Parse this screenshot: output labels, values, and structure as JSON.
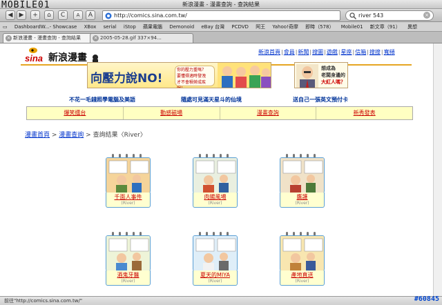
{
  "window": {
    "title": "新浪漫畫 - 漫畫查詢 - 查詢結果",
    "watermark": "MOBILE01"
  },
  "toolbar": {
    "back": "◀",
    "forward": "▶",
    "add": "+",
    "home": "⌂",
    "reload": "C",
    "text_smaller": "A",
    "text_larger": "A",
    "url": "http://comics.sina.com.tw/",
    "search_value": "river 543"
  },
  "bookmarks": [
    "DashboardW...- Showcase",
    "XBox",
    "serial",
    "iStop",
    "蘋果電腦",
    "Demonoid",
    "eBay 台灣",
    "PCDVD",
    "阿王",
    "Yahoo!奇摩",
    "即時（578）",
    "Mobile01",
    "新文章（91）",
    "異想"
  ],
  "tabs": [
    {
      "label": "新浪漫畫 - 漫畫查詢 - 查詢結果"
    },
    {
      "label": "2005-05-28.gif 337×94..."
    }
  ],
  "site": {
    "logo_text": "sina新浪漫畫"
  },
  "toplinks": [
    "新浪首頁",
    "會員",
    "新聞",
    "搜圖",
    "遊戲",
    "星座",
    "信箱",
    "搜搜",
    "寬頻"
  ],
  "banner": {
    "big": "向壓力說NO!",
    "lines": [
      "你的壓力重嗎？",
      "要懂得適時發洩",
      "才不會積勞成疾喔！"
    ]
  },
  "banner2": {
    "lines": [
      "想成為",
      "老闆身邊的",
      "大紅人嗎？"
    ]
  },
  "promos": [
    "不花一毛錢照學電腦及美語",
    "隨處可見滿天星斗的仙境",
    "送自己一張英文預付卡"
  ],
  "menu": [
    "爆笑擂台",
    "動感磁場",
    "漫畫查詢",
    "新秀發表"
  ],
  "breadcrumb": {
    "home": "漫畫首頁",
    "sep": " > ",
    "query": "漫畫查詢",
    "result": "查詢結果〈River〉"
  },
  "results": [
    {
      "title": "千面人事件",
      "author": "(River)"
    },
    {
      "title": "肉腸風場",
      "author": "(River)"
    },
    {
      "title": "鷹護",
      "author": "(River)"
    },
    {
      "title": "酒鬼牙醫",
      "author": "(River)"
    },
    {
      "title": "夏天的MIYA",
      "author": "(River)"
    },
    {
      "title": "產地直送",
      "author": "(River)"
    }
  ],
  "status": "前往\"http://comics.sina.com.tw/\"",
  "counter": "#60845"
}
